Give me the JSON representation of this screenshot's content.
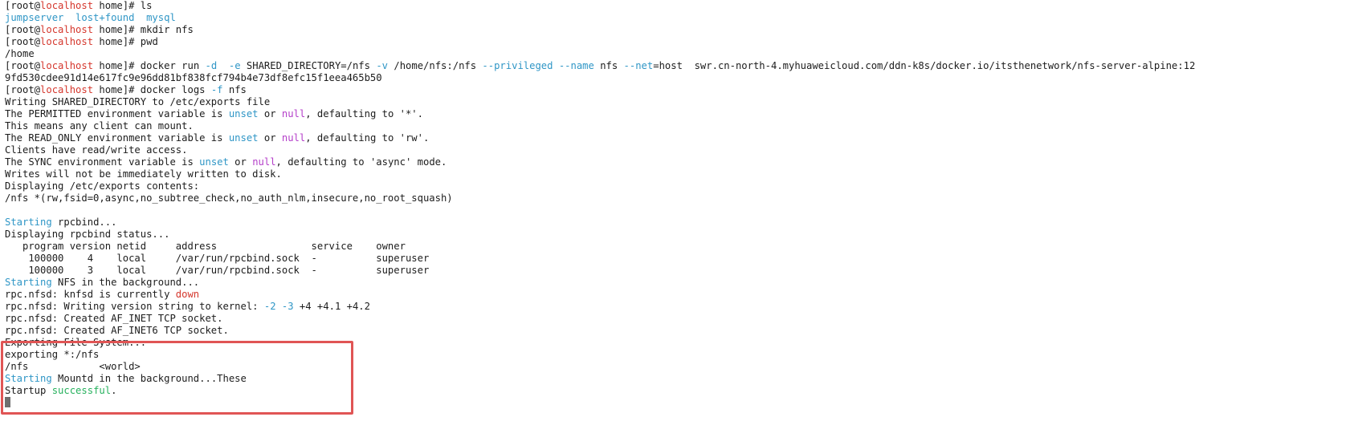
{
  "colors": {
    "background": "#ffffff",
    "text": "#1c1c1c",
    "hostname": "#d5372d",
    "directory": "#2f96c6",
    "option": "#2f96c6",
    "keyword": "#b43ec9",
    "success": "#26b15d",
    "highlight_border": "#e05555"
  },
  "terminal": {
    "lines": [
      [
        {
          "t": "[root@"
        },
        {
          "t": "localhost",
          "c": "red"
        },
        {
          "t": " home]# ls"
        }
      ],
      [
        {
          "t": "jumpserver  lost+found  mysql",
          "c": "blue"
        }
      ],
      [
        {
          "t": "[root@"
        },
        {
          "t": "localhost",
          "c": "red"
        },
        {
          "t": " home]# mkdir nfs"
        }
      ],
      [
        {
          "t": "[root@"
        },
        {
          "t": "localhost",
          "c": "red"
        },
        {
          "t": " home]# pwd"
        }
      ],
      [
        {
          "t": "/home"
        }
      ],
      [
        {
          "t": "[root@"
        },
        {
          "t": "localhost",
          "c": "red"
        },
        {
          "t": " home]# docker run "
        },
        {
          "t": "-d",
          "c": "blue"
        },
        {
          "t": "  "
        },
        {
          "t": "-e",
          "c": "blue"
        },
        {
          "t": " SHARED_DIRECTORY=/nfs "
        },
        {
          "t": "-v",
          "c": "blue"
        },
        {
          "t": " /home/nfs:/nfs "
        },
        {
          "t": "--privileged",
          "c": "blue"
        },
        {
          "t": " "
        },
        {
          "t": "--name",
          "c": "blue"
        },
        {
          "t": " nfs "
        },
        {
          "t": "--net",
          "c": "blue"
        },
        {
          "t": "=host  swr.cn-north-4.myhuaweicloud.com/ddn-k8s/docker.io/itsthenetwork/nfs-server-alpine:12"
        }
      ],
      [
        {
          "t": "9fd530cdee91d14e617fc9e96dd81bf838fcf794b4e73df8efc15f1eea465b50"
        }
      ],
      [
        {
          "t": "[root@"
        },
        {
          "t": "localhost",
          "c": "red"
        },
        {
          "t": " home]# docker logs "
        },
        {
          "t": "-f",
          "c": "blue"
        },
        {
          "t": " nfs"
        }
      ],
      [
        {
          "t": "Writing SHARED_DIRECTORY to /etc/exports file"
        }
      ],
      [
        {
          "t": "The PERMITTED environment variable is "
        },
        {
          "t": "unset",
          "c": "blue"
        },
        {
          "t": " or "
        },
        {
          "t": "null",
          "c": "magenta"
        },
        {
          "t": ", defaulting to '*'."
        }
      ],
      [
        {
          "t": "This means any client can mount."
        }
      ],
      [
        {
          "t": "The READ_ONLY environment variable is "
        },
        {
          "t": "unset",
          "c": "blue"
        },
        {
          "t": " or "
        },
        {
          "t": "null",
          "c": "magenta"
        },
        {
          "t": ", defaulting to 'rw'."
        }
      ],
      [
        {
          "t": "Clients have read/write access."
        }
      ],
      [
        {
          "t": "The SYNC environment variable is "
        },
        {
          "t": "unset",
          "c": "blue"
        },
        {
          "t": " or "
        },
        {
          "t": "null",
          "c": "magenta"
        },
        {
          "t": ", defaulting to 'async' mode."
        }
      ],
      [
        {
          "t": "Writes will not be immediately written to disk."
        }
      ],
      [
        {
          "t": "Displaying /etc/exports contents:"
        }
      ],
      [
        {
          "t": "/nfs *(rw,fsid=0,async,no_subtree_check,no_auth_nlm,insecure,no_root_squash)"
        }
      ],
      [
        {
          "t": ""
        }
      ],
      [
        {
          "t": "Starting",
          "c": "blue"
        },
        {
          "t": " rpcbind..."
        }
      ],
      [
        {
          "t": "Displaying rpcbind status..."
        }
      ],
      [
        {
          "t": "   program version netid     address                service    owner"
        }
      ],
      [
        {
          "t": "    100000    4    local     /var/run/rpcbind.sock  -          superuser"
        }
      ],
      [
        {
          "t": "    100000    3    local     /var/run/rpcbind.sock  -          superuser"
        }
      ],
      [
        {
          "t": "Starting",
          "c": "blue"
        },
        {
          "t": " NFS in the background..."
        }
      ],
      [
        {
          "t": "rpc.nfsd: knfsd is currently "
        },
        {
          "t": "down",
          "c": "red"
        }
      ],
      [
        {
          "t": "rpc.nfsd: Writing version string to kernel: "
        },
        {
          "t": "-2",
          "c": "blue"
        },
        {
          "t": " "
        },
        {
          "t": "-3",
          "c": "blue"
        },
        {
          "t": " +4 +4.1 +4.2"
        }
      ],
      [
        {
          "t": "rpc.nfsd: Created AF_INET TCP socket."
        }
      ],
      [
        {
          "t": "rpc.nfsd: Created AF_INET6 TCP socket."
        }
      ],
      [
        {
          "t": "Exporting File System..."
        }
      ],
      [
        {
          "t": "exporting *:/nfs"
        }
      ],
      [
        {
          "t": "/nfs            <world>"
        }
      ],
      [
        {
          "t": "Starting",
          "c": "blue"
        },
        {
          "t": " Mountd in the background...These"
        }
      ],
      [
        {
          "t": "Startup "
        },
        {
          "t": "successful",
          "c": "green"
        },
        {
          "t": "."
        }
      ],
      [
        {
          "cursor": true
        }
      ]
    ]
  }
}
